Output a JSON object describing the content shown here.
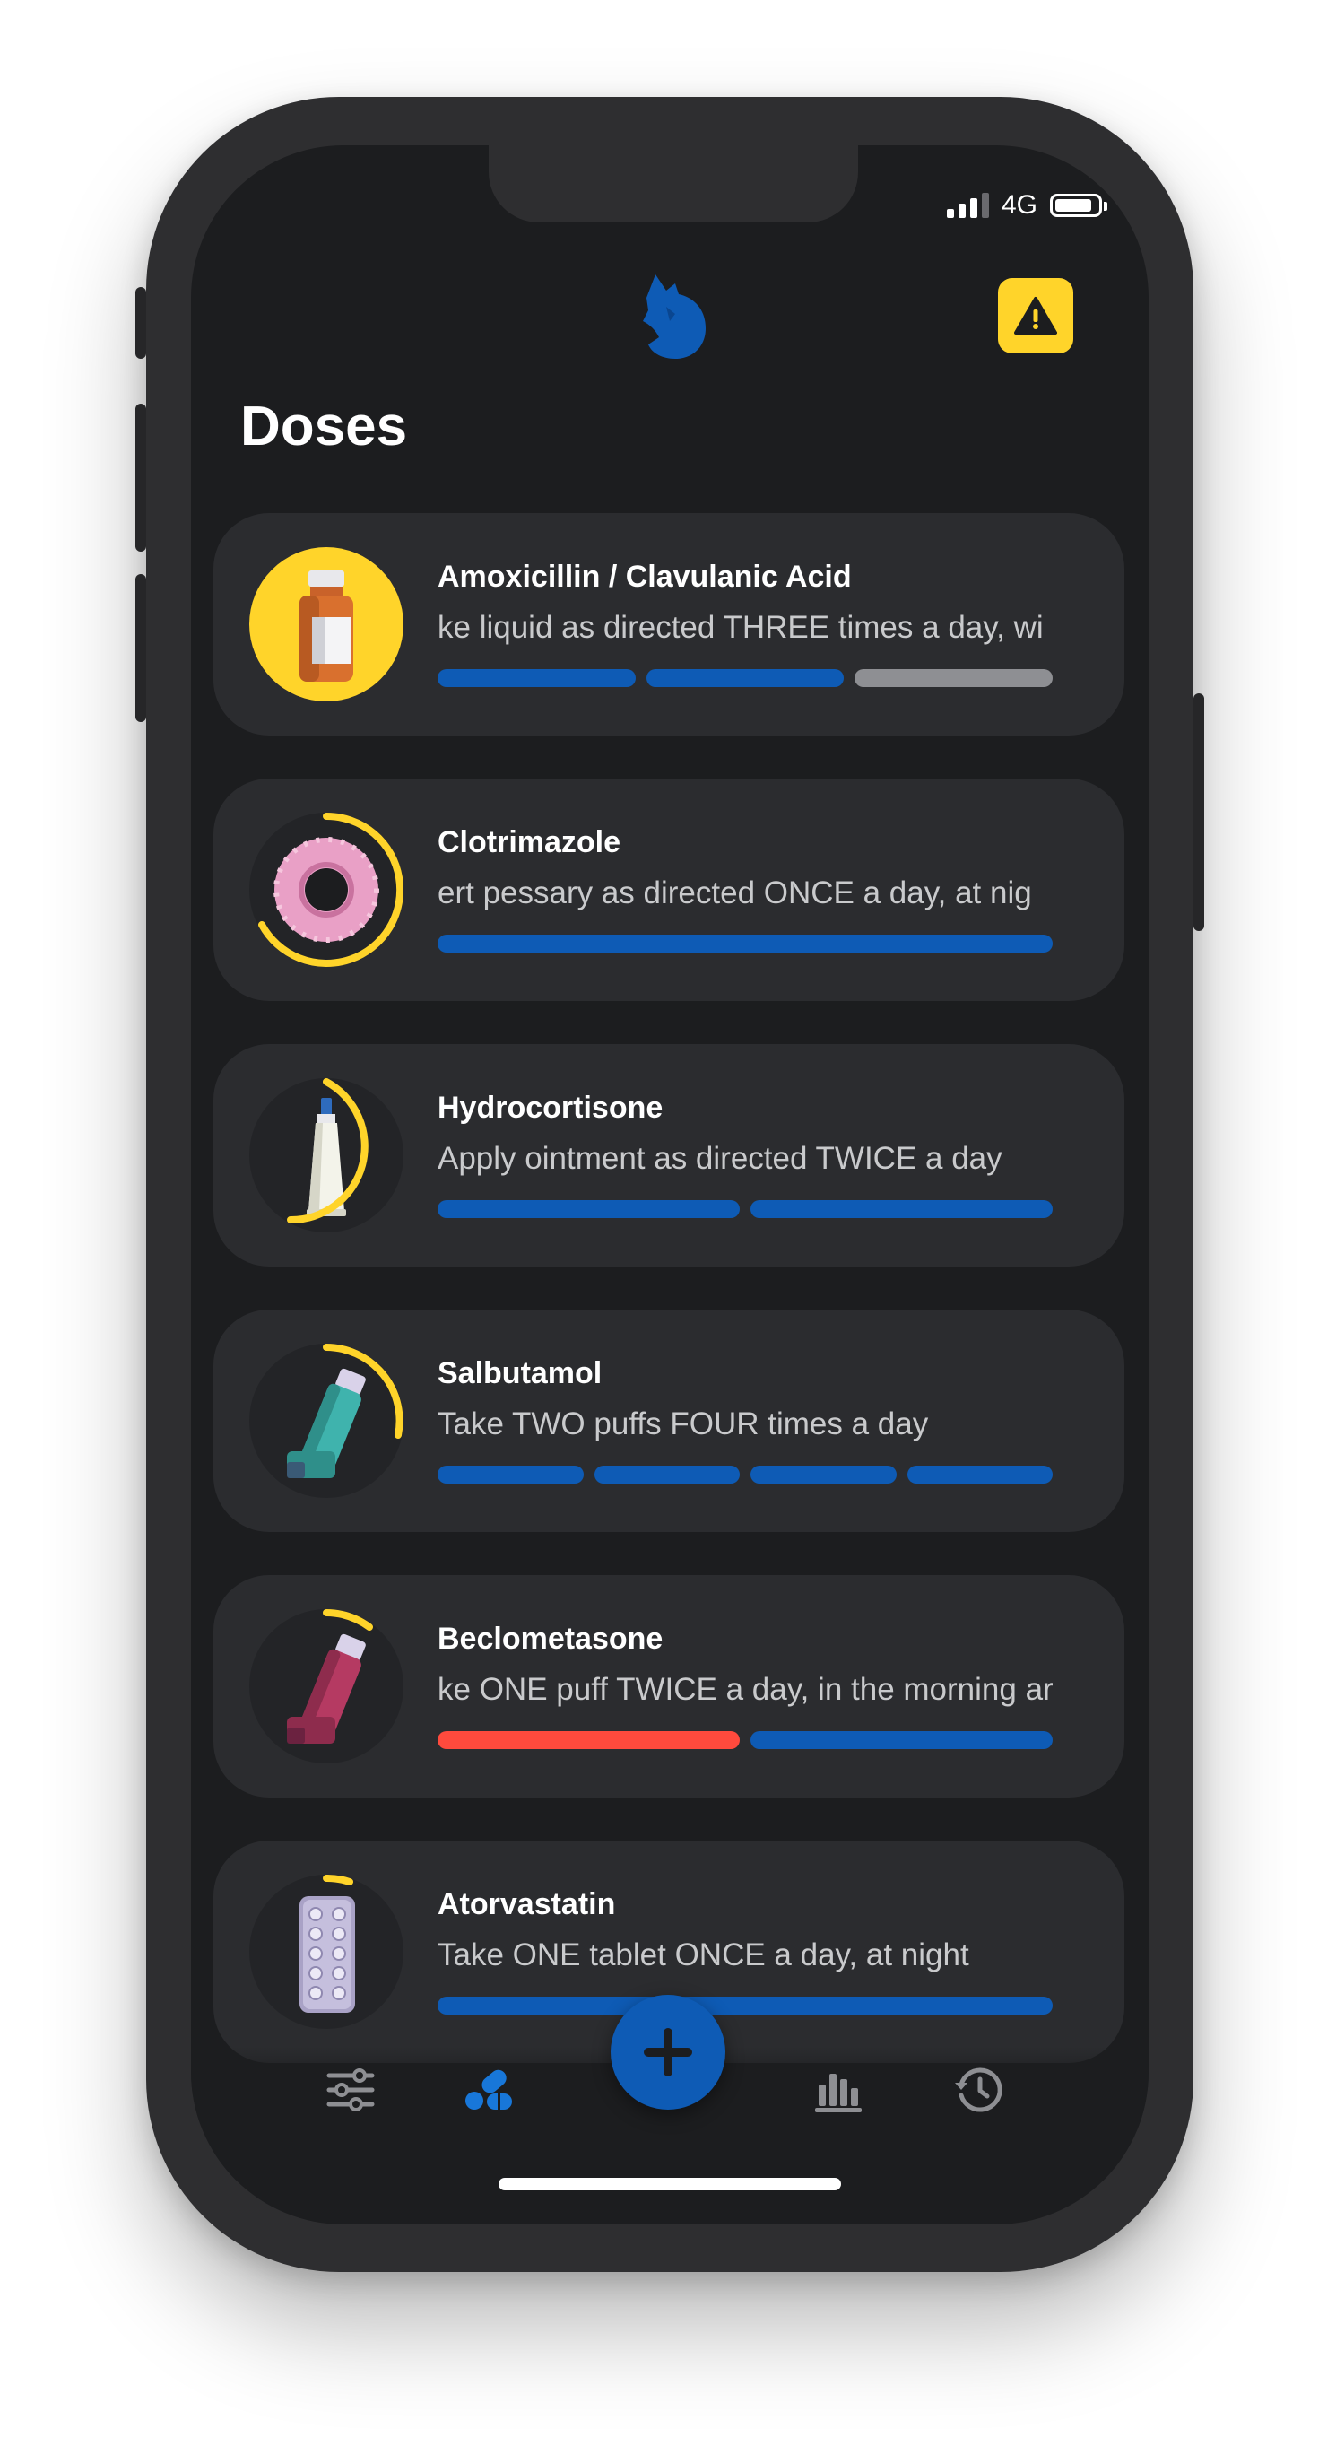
{
  "status_bar": {
    "network": "4G"
  },
  "header": {
    "title": "Doses"
  },
  "doses": [
    {
      "name": "Amoxicillin / Clavulanic Acid",
      "instruction": "ke liquid as directed THREE times a day, wi",
      "icon": "medicine-bottle-icon",
      "progress": [
        "taken",
        "taken",
        "pending"
      ]
    },
    {
      "name": "Clotrimazole",
      "instruction": "ert pessary as directed ONCE a day, at nig",
      "icon": "pessary-icon",
      "progress": [
        "taken"
      ]
    },
    {
      "name": "Hydrocortisone",
      "instruction": "Apply ointment as directed TWICE a day",
      "icon": "ointment-tube-icon",
      "progress": [
        "taken",
        "taken"
      ]
    },
    {
      "name": "Salbutamol",
      "instruction": "Take TWO puffs FOUR times a day",
      "icon": "inhaler-icon",
      "progress": [
        "taken",
        "taken",
        "taken",
        "taken"
      ]
    },
    {
      "name": "Beclometasone",
      "instruction": "ke ONE puff TWICE a day, in the morning ar",
      "icon": "inhaler-icon",
      "progress": [
        "missed",
        "taken"
      ]
    },
    {
      "name": "Atorvastatin",
      "instruction": "Take ONE tablet ONCE a day, at night",
      "icon": "tablet-blister-icon",
      "progress": [
        "taken"
      ]
    }
  ],
  "colors": {
    "accent": "#0e5bb5",
    "warning": "#ffd42a",
    "missed": "#ff4a3d",
    "pending": "#8e8f93",
    "background": "#1c1d1f",
    "card": "#2b2c2f"
  },
  "tabbar": {
    "items": [
      "settings-sliders-icon",
      "pills-icon",
      "add-button",
      "stats-chart-icon",
      "history-icon"
    ],
    "active": "pills-icon"
  }
}
